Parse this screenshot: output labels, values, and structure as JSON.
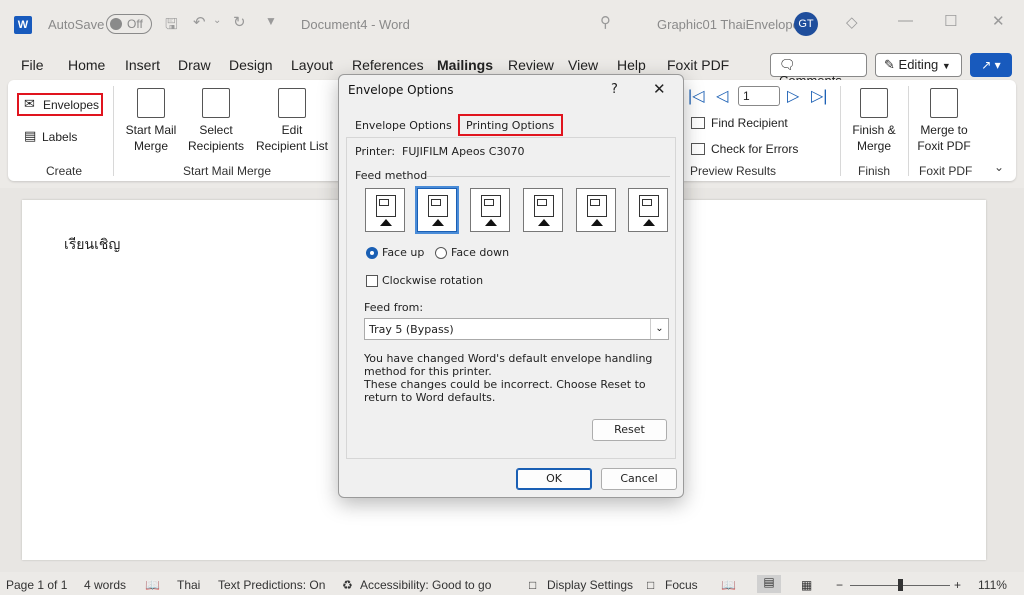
{
  "titlebar": {
    "autosave_label": "AutoSave",
    "autosave_state": "Off",
    "document_title": "Document4 - Word",
    "account_name": "Graphic01 ThaiEnvelope",
    "avatar_initials": "GT"
  },
  "menu": {
    "items": [
      "File",
      "Home",
      "Insert",
      "Draw",
      "Design",
      "Layout",
      "References",
      "Mailings",
      "Review",
      "View",
      "Help",
      "Foxit PDF"
    ],
    "comments_label": "Comments",
    "editing_label": "Editing"
  },
  "ribbon": {
    "envelopes_label": "Envelopes",
    "labels_label": "Labels",
    "create_group": "Create",
    "start_mail_merge_l1": "Start Mail",
    "start_mail_merge_l2": "Merge",
    "select_recipients_l1": "Select",
    "select_recipients_l2": "Recipients",
    "edit_list_l1": "Edit",
    "edit_list_l2": "Recipient List",
    "start_mail_merge_group": "Start Mail Merge",
    "record_number": "1",
    "find_recipient": "Find Recipient",
    "check_errors": "Check for Errors",
    "preview_group": "Preview Results",
    "finish_merge_l1": "Finish &",
    "finish_merge_l2": "Merge",
    "finish_group": "Finish",
    "merge_foxit_l1": "Merge to",
    "merge_foxit_l2": "Foxit PDF",
    "foxit_group": "Foxit PDF"
  },
  "document": {
    "text": "เรียนเชิญ"
  },
  "dialog": {
    "title": "Envelope Options",
    "help": "?",
    "tabs": [
      "Envelope Options",
      "Printing Options"
    ],
    "printer_label": "Printer:",
    "printer_name": "FUJIFILM Apeos C3070",
    "feed_method_label": "Feed method",
    "face_up": "Face up",
    "face_down": "Face down",
    "clockwise": "Clockwise rotation",
    "feed_from_label": "Feed from:",
    "feed_from_value": "Tray 5 (Bypass)",
    "message_1": "You have changed Word's default envelope handling method for this printer.",
    "message_2": "These changes could be incorrect. Choose Reset to return to Word defaults.",
    "reset": "Reset",
    "ok": "OK",
    "cancel": "Cancel"
  },
  "statusbar": {
    "page": "Page 1 of 1",
    "words": "4 words",
    "language": "Thai",
    "predictions": "Text Predictions: On",
    "accessibility": "Accessibility: Good to go",
    "display_settings": "Display Settings",
    "focus": "Focus",
    "zoom": "111%"
  },
  "colors": {
    "accent": "#185abd",
    "highlight_red": "#e0141e",
    "avatar": "#1f4e9c"
  }
}
